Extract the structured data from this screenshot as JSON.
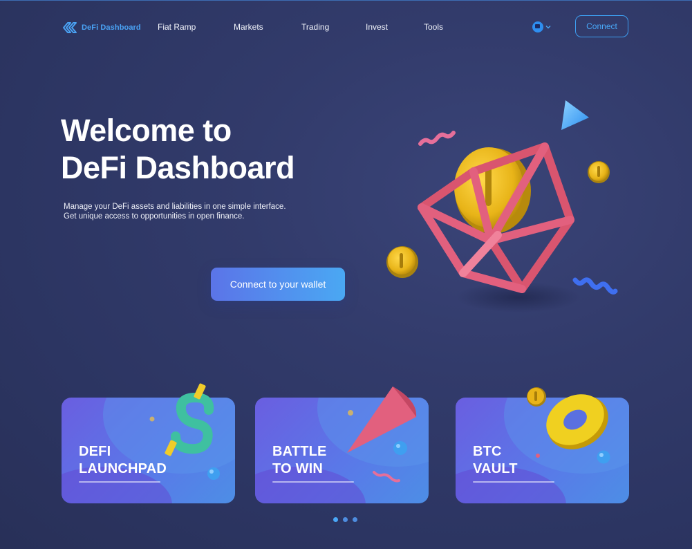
{
  "header": {
    "logo_text": "DeFi Dashboard",
    "nav": [
      "Fiat Ramp",
      "Markets",
      "Trading",
      "Invest",
      "Tools"
    ],
    "connect_label": "Connect"
  },
  "hero": {
    "title_line1": "Welcome to",
    "title_line2": "DeFi Dashboard",
    "desc_line1": "Manage your DeFi assets and liabilities in one simple interface.",
    "desc_line2": "Get unique access to opportunities in open finance.",
    "cta_label": "Connect to your wallet"
  },
  "cards": [
    {
      "line1": "DEFI",
      "line2": "LAUNCHPAD"
    },
    {
      "line1": "BATTLE",
      "line2": "TO WIN"
    },
    {
      "line1": "BTC",
      "line2": "VAULT"
    }
  ],
  "carousel": {
    "pages": 3,
    "active": 0
  },
  "colors": {
    "accent": "#4aa8f8",
    "background": "#2c3562",
    "cube": "#e2607e",
    "coin": "#e8b418"
  }
}
